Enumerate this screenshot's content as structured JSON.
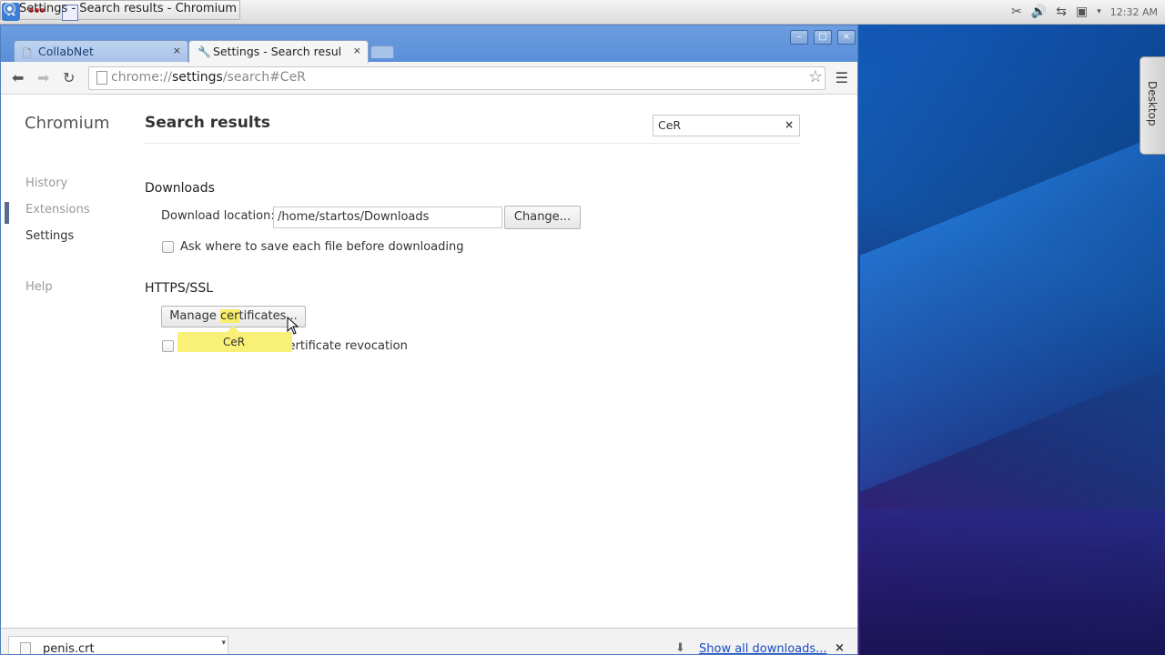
{
  "panel": {
    "task_label": "Settings - Search results - Chromium",
    "clock": "12:32 AM"
  },
  "desktop_widget": {
    "label": "Desktop"
  },
  "browser": {
    "tabs": [
      {
        "title": "CollabNet",
        "close": "×"
      },
      {
        "title": "Settings - Search results",
        "close": "×"
      }
    ],
    "window_controls": {
      "minimize": "–",
      "maximize": "□",
      "close": "×"
    },
    "omnibox": {
      "scheme": "chrome://",
      "host": "settings",
      "path": "/search#CeR"
    }
  },
  "settings": {
    "brand": "Chromium",
    "nav": {
      "history": "History",
      "extensions": "Extensions",
      "settings": "Settings",
      "help": "Help"
    },
    "page_title": "Search results",
    "search_value": "CeR",
    "downloads": {
      "title": "Downloads",
      "location_label": "Download location:",
      "location_value": "/home/startos/Downloads",
      "change_button": "Change...",
      "ask_label": "Ask where to save each file before downloading"
    },
    "https": {
      "title": "HTTPS/SSL",
      "manage_pre": "Manage ",
      "manage_hl": "cer",
      "manage_post": "tificates...",
      "revocation_label": "Check for server certificate revocation",
      "bubble": "CeR"
    }
  },
  "shelf": {
    "file_name": "penis.crt",
    "show_all": "Show all downloads...",
    "close": "×"
  },
  "colors": {
    "accent": "#1a4bc2",
    "highlight": "#f8f077",
    "titlebar": "#5a8fd9"
  }
}
